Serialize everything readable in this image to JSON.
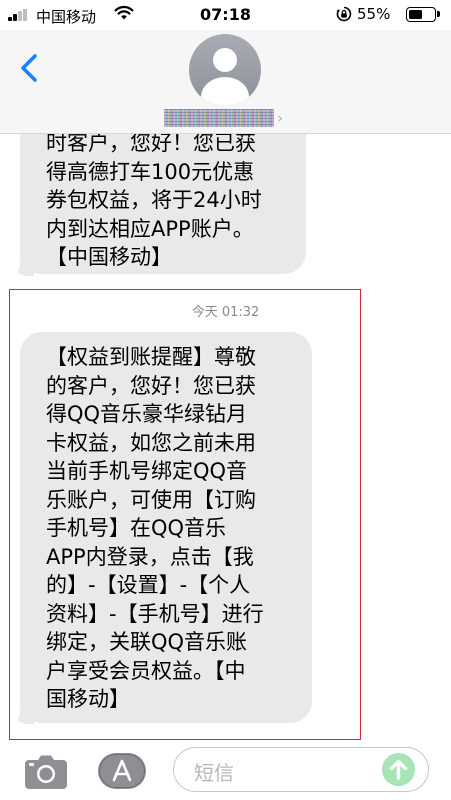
{
  "status_bar": {
    "carrier": "中国移动",
    "time": "07:18",
    "battery_percent": "55%",
    "battery_level": 0.55
  },
  "header": {
    "contact_name": "(obscured)",
    "icons": [
      "back-chevron-icon",
      "contact-avatar-icon",
      "chevron-right-icon"
    ]
  },
  "messages": [
    {
      "text": "时客户，您好！您已获\n得高德打车100元优惠\n券包权益，将于24小时\n内到达相应APP账户。\n【中国移动】"
    },
    {
      "timestamp": "今天 01:32",
      "text": "【权益到账提醒】尊敬\n的客户，您好！您已获\n得QQ音乐豪华绿钻月\n卡权益，如您之前未用\n当前手机号绑定QQ音\n乐账户，可使用【订购\n手机号】在QQ音乐\nAPP内登录，点击【我\n的】-【设置】-【个人\n资料】-【手机号】进行\n绑定，关联QQ音乐账\n户享受会员权益。【中\n国移动】"
    }
  ],
  "composer": {
    "placeholder": "短信",
    "icons": [
      "camera-icon",
      "app-store-icon",
      "send-arrow-icon"
    ]
  },
  "colors": {
    "bubble": "#e9e9eb",
    "accent": "#1a82fb",
    "highlight": "#d9262f",
    "send": "#a9e4b7"
  }
}
